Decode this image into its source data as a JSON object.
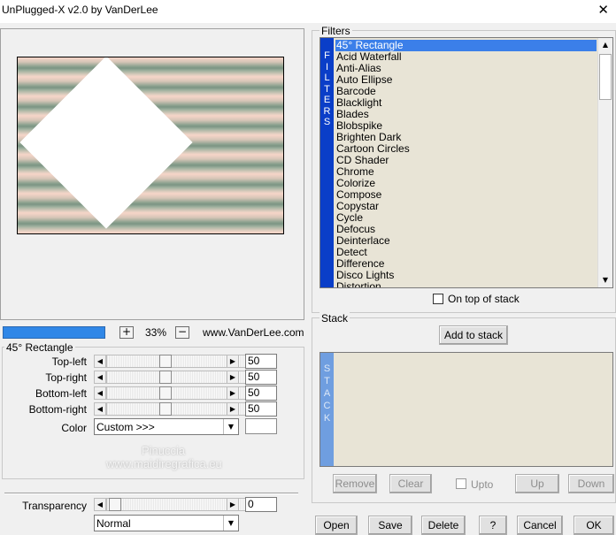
{
  "window": {
    "title": "UnPlugged-X v2.0 by VanDerLee",
    "close_glyph": "✕"
  },
  "preview": {
    "zoom_minus": "−",
    "zoom_plus": "+",
    "zoom_value": "33%",
    "website": "www.VanDerLee.com"
  },
  "params": {
    "group_title": "45° Rectangle",
    "sliders": [
      {
        "label": "Top-left",
        "value": "50"
      },
      {
        "label": "Top-right",
        "value": "50"
      },
      {
        "label": "Bottom-left",
        "value": "50"
      },
      {
        "label": "Bottom-right",
        "value": "50"
      }
    ],
    "color": {
      "label": "Color",
      "value": "Custom >>>"
    },
    "transparency": {
      "label": "Transparency",
      "value": "0"
    },
    "blend_mode": "Normal"
  },
  "filters": {
    "group_title": "Filters",
    "band_letters": [
      "F",
      "I",
      "L",
      "T",
      "E",
      "R",
      "S"
    ],
    "items": [
      "45° Rectangle",
      "Acid Waterfall",
      "Anti-Alias",
      "Auto Ellipse",
      "Barcode",
      "Blacklight",
      "Blades",
      "Blobspike",
      "Brighten Dark",
      "Cartoon Circles",
      "CD Shader",
      "Chrome",
      "Colorize",
      "Compose",
      "Copystar",
      "Cycle",
      "Defocus",
      "Deinterlace",
      "Detect",
      "Difference",
      "Disco Lights",
      "Distortion"
    ],
    "selected_index": 0,
    "on_top_label": "On top of stack"
  },
  "stack": {
    "group_title": "Stack",
    "add_button": "Add to stack",
    "band_letters": [
      "S",
      "T",
      "A",
      "C",
      "K"
    ],
    "remove": "Remove",
    "clear": "Clear",
    "upto": "Upto",
    "up": "Up",
    "down": "Down"
  },
  "footer": {
    "open": "Open",
    "save": "Save",
    "delete": "Delete",
    "help": "?",
    "cancel": "Cancel",
    "ok": "OK"
  },
  "watermark": {
    "name": "Pinuccia",
    "site": "www.maidiregrafica.eu"
  },
  "colors": {
    "selection": "#3b7fe9",
    "filters_band": "#0a3ec8",
    "stack_band": "#6f9ee0",
    "list_bg": "#e8e4d6"
  }
}
